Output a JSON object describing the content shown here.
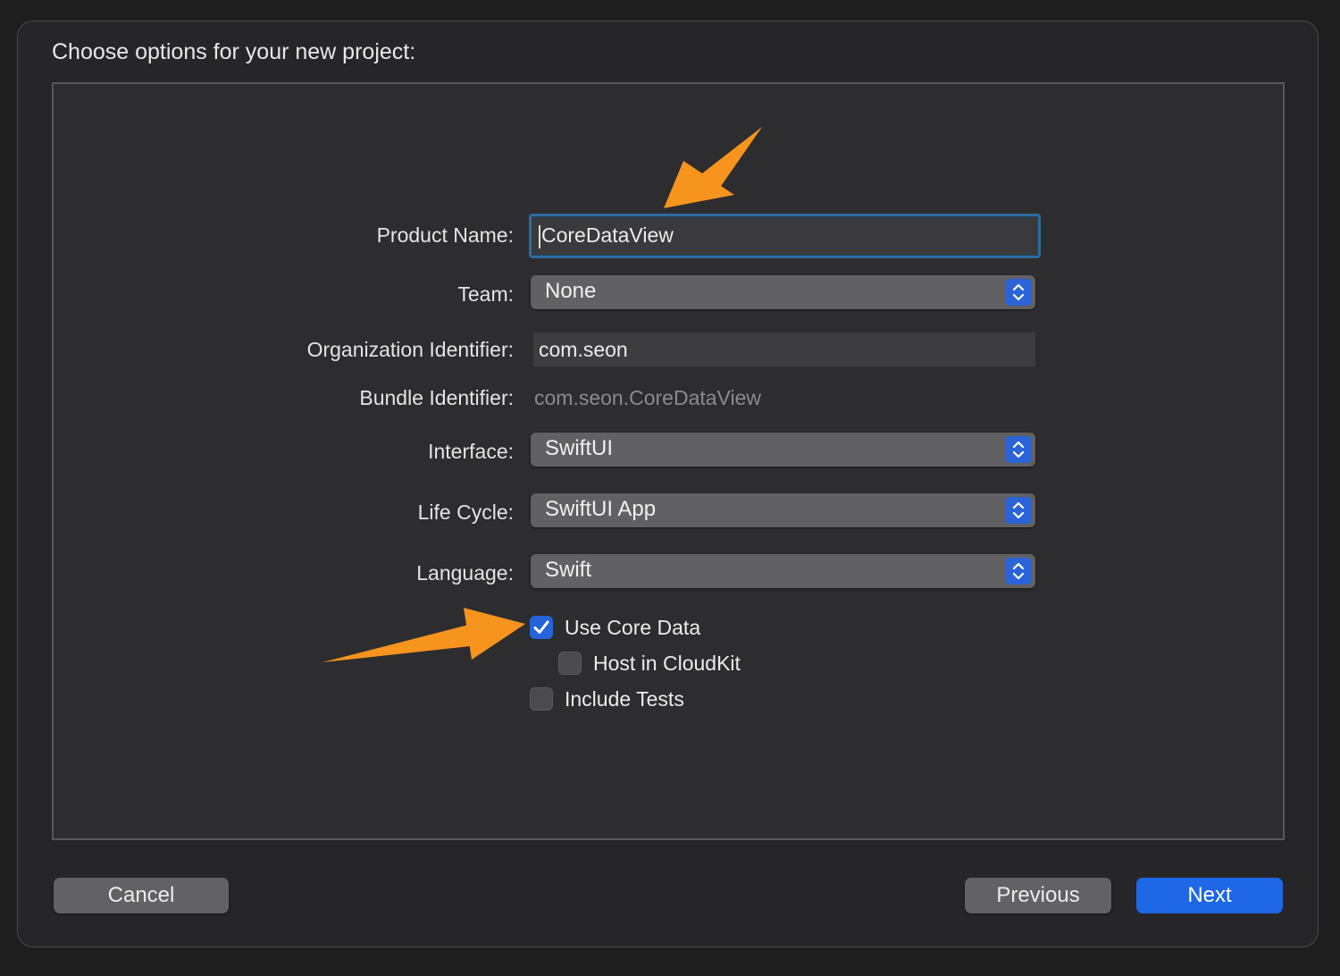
{
  "dialog": {
    "title": "Choose options for your new project:"
  },
  "form": {
    "product_name": {
      "label": "Product Name:",
      "value": "CoreDataView"
    },
    "team": {
      "label": "Team:",
      "value": "None"
    },
    "organization_identifier": {
      "label": "Organization Identifier:",
      "value": "com.seon"
    },
    "bundle_identifier": {
      "label": "Bundle Identifier:",
      "value": "com.seon.CoreDataView"
    },
    "interface": {
      "label": "Interface:",
      "value": "SwiftUI"
    },
    "life_cycle": {
      "label": "Life Cycle:",
      "value": "SwiftUI App"
    },
    "language": {
      "label": "Language:",
      "value": "Swift"
    },
    "options": {
      "use_core_data": {
        "label": "Use Core Data",
        "checked": true
      },
      "host_in_cloudkit": {
        "label": "Host in CloudKit",
        "checked": false
      },
      "include_tests": {
        "label": "Include Tests",
        "checked": false
      }
    }
  },
  "buttons": {
    "cancel": "Cancel",
    "previous": "Previous",
    "next": "Next"
  },
  "colors": {
    "accent": "#1e67e6",
    "annotation_arrow": "#f7941d",
    "focus_ring": "#2f6a9c"
  }
}
